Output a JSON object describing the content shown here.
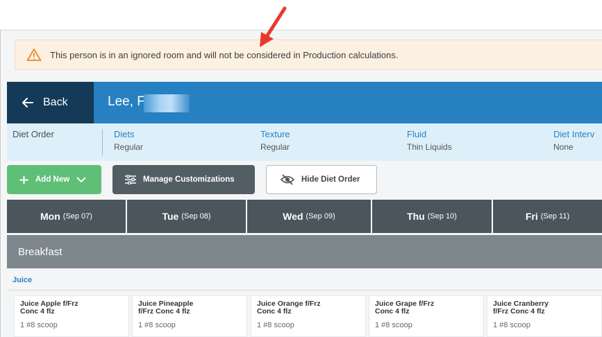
{
  "warning": {
    "text": "This person is in an ignored room and will not be considered in Production calculations."
  },
  "header": {
    "back_label": "Back",
    "patient_name": "Lee, F"
  },
  "diet": {
    "order_label": "Diet Order",
    "columns": [
      {
        "title": "Diets",
        "value": "Regular"
      },
      {
        "title": "Texture",
        "value": "Regular"
      },
      {
        "title": "Fluid",
        "value": "Thin Liquids"
      },
      {
        "title": "Diet Interv",
        "value": "None"
      }
    ]
  },
  "toolbar": {
    "add_new": "Add New",
    "manage": "Manage Customizations",
    "hide": "Hide Diet Order"
  },
  "days": [
    {
      "name": "Mon",
      "date": "(Sep 07)"
    },
    {
      "name": "Tue",
      "date": "(Sep 08)"
    },
    {
      "name": "Wed",
      "date": "(Sep 09)"
    },
    {
      "name": "Thu",
      "date": "(Sep 10)"
    },
    {
      "name": "Fri",
      "date": "(Sep 11)"
    }
  ],
  "meal": {
    "name": "Breakfast"
  },
  "section": {
    "name": "Juice"
  },
  "items": [
    {
      "name_line1": "Juice Apple f/Frz",
      "name_line2": "Conc 4 flz",
      "detail": "1 #8 scoop"
    },
    {
      "name_line1": "Juice Pineapple",
      "name_line2": "f/Frz Conc 4 flz",
      "detail": "1 #8 scoop"
    },
    {
      "name_line1": "Juice Orange f/Frz",
      "name_line2": "Conc 4 flz",
      "detail": "1 #8 scoop"
    },
    {
      "name_line1": "Juice Grape f/Frz",
      "name_line2": "Conc 4 flz",
      "detail": "1 #8 scoop"
    },
    {
      "name_line1": "Juice Cranberry",
      "name_line2": "f/Frz Conc 4 flz",
      "detail": "1 #8 scoop"
    }
  ],
  "colors": {
    "header_blue": "#2680c1",
    "back_navy": "#153a57",
    "add_green": "#5fbf77",
    "warning_bg": "#fcf0e2",
    "annotation_red": "#e8392f"
  }
}
